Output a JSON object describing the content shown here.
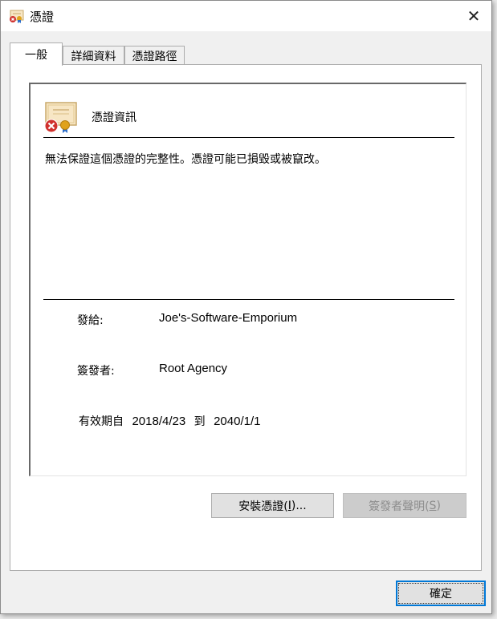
{
  "window": {
    "title": "憑證",
    "close_glyph": "✕"
  },
  "tabs": [
    {
      "label": "一般",
      "active": true
    },
    {
      "label": "詳細資料",
      "active": false
    },
    {
      "label": "憑證路徑",
      "active": false
    }
  ],
  "general": {
    "header": "憑證資訊",
    "warning": "無法保證這個憑證的完整性。憑證可能已損毀或被竄改。",
    "issued_to_label": "發給:",
    "issued_to_value": "Joe's-Software-Emporium",
    "issued_by_label": "簽發者:",
    "issued_by_value": "Root Agency",
    "validity_from_label": "有效期自",
    "validity_from": "2018/4/23",
    "validity_to_label": "到",
    "validity_to": "2040/1/1"
  },
  "buttons": {
    "install_text": "安裝憑證(",
    "install_accel": "I",
    "install_suffix": ")...",
    "issuer_text": "簽發者聲明(",
    "issuer_accel": "S",
    "issuer_suffix": ")",
    "ok": "確定"
  },
  "icons": {
    "title": "certificate-error-icon",
    "info": "certificate-error-icon",
    "close": "close-icon"
  },
  "colors": {
    "error_red": "#d0312d",
    "ribbon_blue": "#2d6ec9",
    "seal_gold": "#e0a21a",
    "accent": "#0078d7"
  }
}
